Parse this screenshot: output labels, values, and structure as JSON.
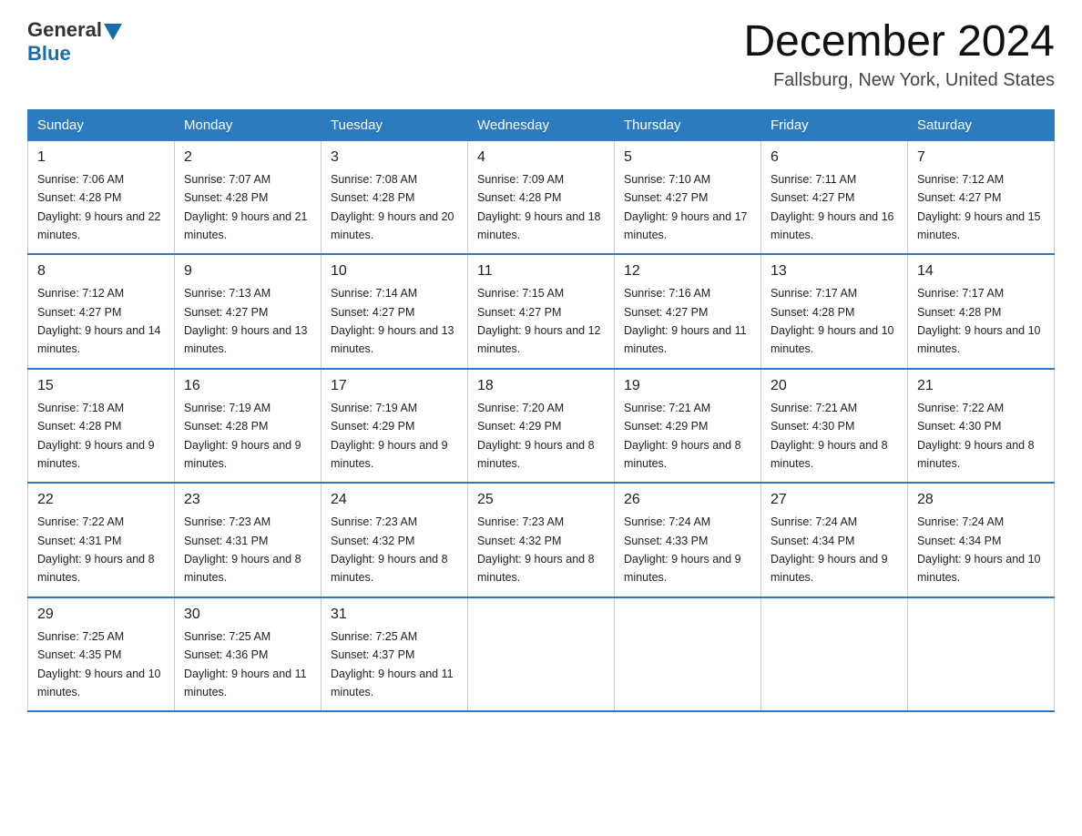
{
  "header": {
    "logo_general": "General",
    "logo_blue": "Blue",
    "month_title": "December 2024",
    "location": "Fallsburg, New York, United States"
  },
  "days_of_week": [
    "Sunday",
    "Monday",
    "Tuesday",
    "Wednesday",
    "Thursday",
    "Friday",
    "Saturday"
  ],
  "weeks": [
    [
      {
        "day": "1",
        "sunrise": "7:06 AM",
        "sunset": "4:28 PM",
        "daylight": "9 hours and 22 minutes."
      },
      {
        "day": "2",
        "sunrise": "7:07 AM",
        "sunset": "4:28 PM",
        "daylight": "9 hours and 21 minutes."
      },
      {
        "day": "3",
        "sunrise": "7:08 AM",
        "sunset": "4:28 PM",
        "daylight": "9 hours and 20 minutes."
      },
      {
        "day": "4",
        "sunrise": "7:09 AM",
        "sunset": "4:28 PM",
        "daylight": "9 hours and 18 minutes."
      },
      {
        "day": "5",
        "sunrise": "7:10 AM",
        "sunset": "4:27 PM",
        "daylight": "9 hours and 17 minutes."
      },
      {
        "day": "6",
        "sunrise": "7:11 AM",
        "sunset": "4:27 PM",
        "daylight": "9 hours and 16 minutes."
      },
      {
        "day": "7",
        "sunrise": "7:12 AM",
        "sunset": "4:27 PM",
        "daylight": "9 hours and 15 minutes."
      }
    ],
    [
      {
        "day": "8",
        "sunrise": "7:12 AM",
        "sunset": "4:27 PM",
        "daylight": "9 hours and 14 minutes."
      },
      {
        "day": "9",
        "sunrise": "7:13 AM",
        "sunset": "4:27 PM",
        "daylight": "9 hours and 13 minutes."
      },
      {
        "day": "10",
        "sunrise": "7:14 AM",
        "sunset": "4:27 PM",
        "daylight": "9 hours and 13 minutes."
      },
      {
        "day": "11",
        "sunrise": "7:15 AM",
        "sunset": "4:27 PM",
        "daylight": "9 hours and 12 minutes."
      },
      {
        "day": "12",
        "sunrise": "7:16 AM",
        "sunset": "4:27 PM",
        "daylight": "9 hours and 11 minutes."
      },
      {
        "day": "13",
        "sunrise": "7:17 AM",
        "sunset": "4:28 PM",
        "daylight": "9 hours and 10 minutes."
      },
      {
        "day": "14",
        "sunrise": "7:17 AM",
        "sunset": "4:28 PM",
        "daylight": "9 hours and 10 minutes."
      }
    ],
    [
      {
        "day": "15",
        "sunrise": "7:18 AM",
        "sunset": "4:28 PM",
        "daylight": "9 hours and 9 minutes."
      },
      {
        "day": "16",
        "sunrise": "7:19 AM",
        "sunset": "4:28 PM",
        "daylight": "9 hours and 9 minutes."
      },
      {
        "day": "17",
        "sunrise": "7:19 AM",
        "sunset": "4:29 PM",
        "daylight": "9 hours and 9 minutes."
      },
      {
        "day": "18",
        "sunrise": "7:20 AM",
        "sunset": "4:29 PM",
        "daylight": "9 hours and 8 minutes."
      },
      {
        "day": "19",
        "sunrise": "7:21 AM",
        "sunset": "4:29 PM",
        "daylight": "9 hours and 8 minutes."
      },
      {
        "day": "20",
        "sunrise": "7:21 AM",
        "sunset": "4:30 PM",
        "daylight": "9 hours and 8 minutes."
      },
      {
        "day": "21",
        "sunrise": "7:22 AM",
        "sunset": "4:30 PM",
        "daylight": "9 hours and 8 minutes."
      }
    ],
    [
      {
        "day": "22",
        "sunrise": "7:22 AM",
        "sunset": "4:31 PM",
        "daylight": "9 hours and 8 minutes."
      },
      {
        "day": "23",
        "sunrise": "7:23 AM",
        "sunset": "4:31 PM",
        "daylight": "9 hours and 8 minutes."
      },
      {
        "day": "24",
        "sunrise": "7:23 AM",
        "sunset": "4:32 PM",
        "daylight": "9 hours and 8 minutes."
      },
      {
        "day": "25",
        "sunrise": "7:23 AM",
        "sunset": "4:32 PM",
        "daylight": "9 hours and 8 minutes."
      },
      {
        "day": "26",
        "sunrise": "7:24 AM",
        "sunset": "4:33 PM",
        "daylight": "9 hours and 9 minutes."
      },
      {
        "day": "27",
        "sunrise": "7:24 AM",
        "sunset": "4:34 PM",
        "daylight": "9 hours and 9 minutes."
      },
      {
        "day": "28",
        "sunrise": "7:24 AM",
        "sunset": "4:34 PM",
        "daylight": "9 hours and 10 minutes."
      }
    ],
    [
      {
        "day": "29",
        "sunrise": "7:25 AM",
        "sunset": "4:35 PM",
        "daylight": "9 hours and 10 minutes."
      },
      {
        "day": "30",
        "sunrise": "7:25 AM",
        "sunset": "4:36 PM",
        "daylight": "9 hours and 11 minutes."
      },
      {
        "day": "31",
        "sunrise": "7:25 AM",
        "sunset": "4:37 PM",
        "daylight": "9 hours and 11 minutes."
      },
      null,
      null,
      null,
      null
    ]
  ]
}
